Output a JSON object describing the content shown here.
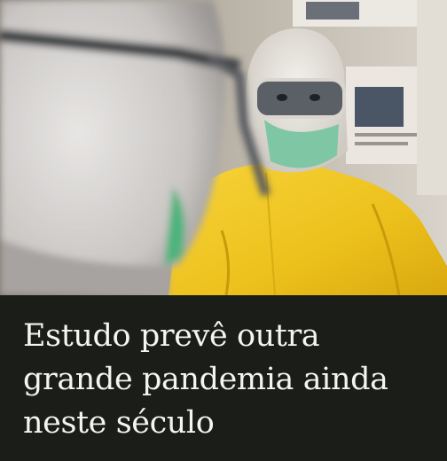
{
  "post": {
    "photo": {
      "description_icon": "photo-healthcare-workers-ppe"
    },
    "headline_lines": [
      "Estudo prevê outra",
      "grande pandemia ainda",
      "neste século"
    ]
  },
  "colors": {
    "background": "#1b1d19",
    "headline_text": "#f4f4f2",
    "suit_yellow": "#f0c419"
  }
}
